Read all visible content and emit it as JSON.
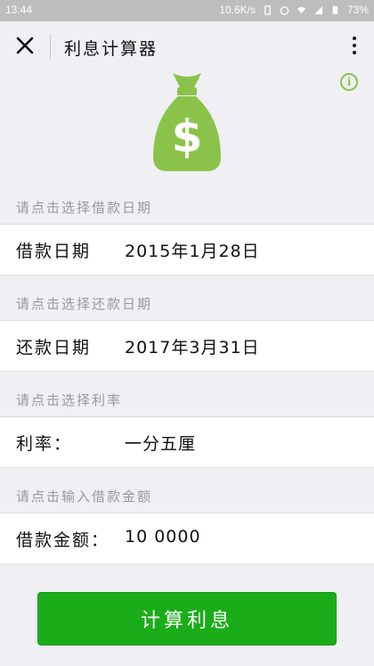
{
  "status_bar": {
    "time": "13:44",
    "network_speed": "10.6K/s",
    "battery": "73%"
  },
  "header": {
    "title": "利息计算器",
    "close_icon": "close-icon",
    "more_icon": "more-vertical-icon"
  },
  "hero": {
    "icon": "money-bag-icon",
    "icon_color": "#8bc34a",
    "info_icon": "info-icon",
    "info_glyph": "i"
  },
  "form": {
    "loan_date": {
      "hint": "请点击选择借款日期",
      "label": "借款日期",
      "value": "2015年1月28日"
    },
    "return_date": {
      "hint": "请点击选择还款日期",
      "label": "还款日期",
      "value": "2017年3月31日"
    },
    "rate": {
      "hint": "请点击选择利率",
      "label": "利率：",
      "value": "一分五厘"
    },
    "amount": {
      "hint": "请点击输入借款金额",
      "label": "借款金额：",
      "value": "10 0000"
    }
  },
  "actions": {
    "calculate_label": "计算利息",
    "button_color": "#1aad19"
  }
}
